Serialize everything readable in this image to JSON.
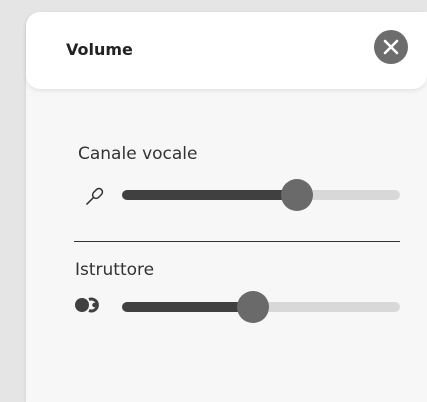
{
  "header": {
    "title": "Volume"
  },
  "voice_channel": {
    "label": "Canale vocale",
    "icon": "microphone-icon",
    "level": 0.63
  },
  "instructor": {
    "label": "Istruttore",
    "icon": "instructor-icon",
    "level": 0.47
  },
  "colors": {
    "fill": "#404040",
    "track": "#d8d8d8",
    "thumb": "#6a6a6a",
    "close_button": "#6d6d6d"
  }
}
